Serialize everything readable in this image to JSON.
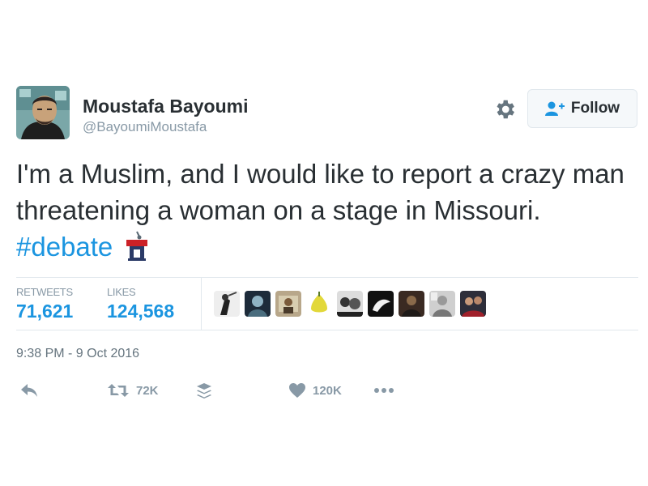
{
  "user": {
    "name": "Moustafa Bayoumi",
    "handle": "@BayoumiMoustafa"
  },
  "follow_button": {
    "label": "Follow"
  },
  "tweet": {
    "text": "I'm a Muslim, and I would like to report a crazy man threatening a woman on a stage in Missouri.",
    "hashtag": "#debate",
    "timestamp": "9:38 PM - 9 Oct 2016"
  },
  "stats": {
    "retweets_label": "RETWEETS",
    "retweets_value": "71,621",
    "likes_label": "LIKES",
    "likes_value": "124,568"
  },
  "actions": {
    "retweet_count": "72K",
    "like_count": "120K"
  },
  "colors": {
    "link": "#1b95e0",
    "text": "#292f33",
    "muted": "#8899a6",
    "border": "#e1e8ed"
  },
  "icons": [
    "gear-icon",
    "add-user-icon",
    "podium-emoji-icon",
    "reply-icon",
    "retweet-icon",
    "buffer-icon",
    "heart-icon",
    "more-icon"
  ]
}
